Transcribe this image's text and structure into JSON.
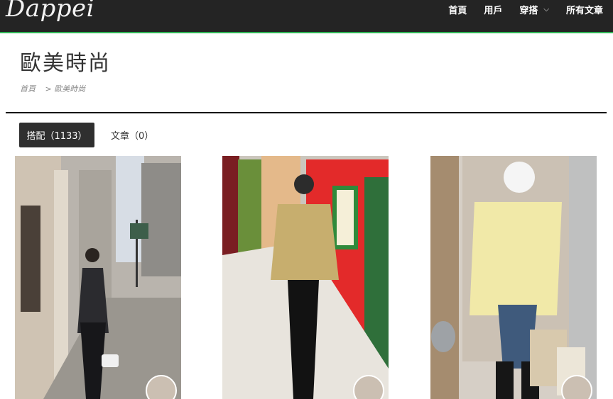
{
  "brand": {
    "logo_text": "Dappei"
  },
  "nav": {
    "items": [
      {
        "label": "首頁"
      },
      {
        "label": "用戶"
      },
      {
        "label": "穿搭",
        "has_dropdown": true
      },
      {
        "label": "所有文章"
      }
    ]
  },
  "page": {
    "title": "歐美時尚",
    "breadcrumb": {
      "home": "首頁",
      "current": "> 歐美時尚"
    }
  },
  "tabs": [
    {
      "label": "搭配（1133）",
      "active": true
    },
    {
      "label": "文章（0）",
      "active": false
    }
  ],
  "colors": {
    "topbar": "#242424",
    "accent": "#2fb455",
    "active_tab": "#2f2f2f"
  }
}
